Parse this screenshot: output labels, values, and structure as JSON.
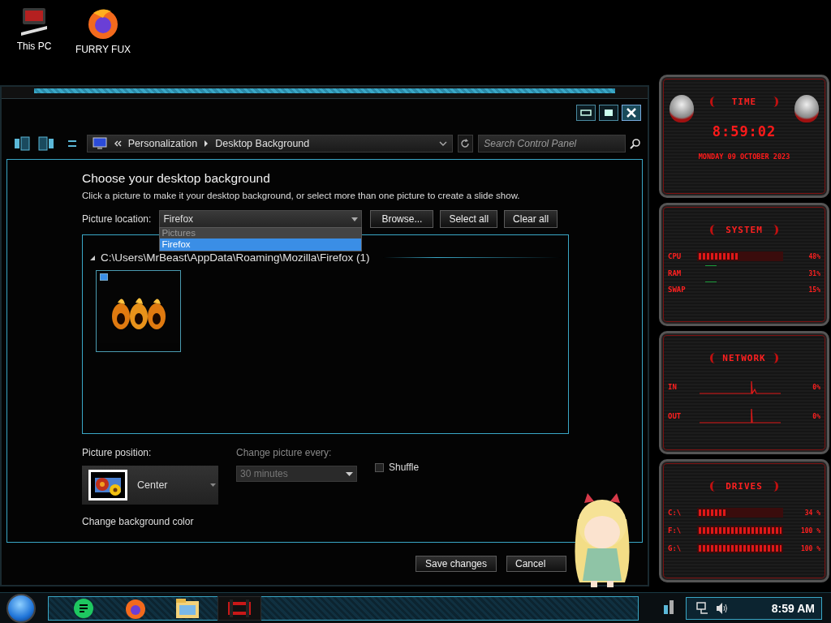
{
  "desktop_icons": [
    {
      "kind": "computer",
      "label": "This PC"
    },
    {
      "kind": "browser",
      "label": "FURRY FUX"
    }
  ],
  "window": {
    "address": {
      "crumbs": [
        "Personalization",
        "Desktop Background"
      ]
    },
    "search": {
      "placeholder": "Search Control Panel"
    },
    "heading": "Choose your desktop background",
    "description": "Click a picture to make it your desktop background, or select more than one picture to create a slide show.",
    "location": {
      "label": "Picture location:",
      "value": "Firefox",
      "options": [
        {
          "label": "Pictures",
          "selected": false
        },
        {
          "label": "Firefox",
          "selected": true
        }
      ]
    },
    "buttons": [
      "Browse...",
      "Select all",
      "Clear all"
    ],
    "group": {
      "path": "C:\\Users\\MrBeast\\AppData\\Roaming\\Mozilla\\Firefox (1)",
      "expanded": true,
      "items": [
        {
          "kind": "picture",
          "selected": true,
          "checked": true
        }
      ]
    },
    "position": {
      "label": "Picture position:",
      "value": "Center"
    },
    "interval": {
      "label": "Change picture every:",
      "value": "30 minutes",
      "disabled": true
    },
    "shuffle": {
      "label": "Shuffle",
      "checked": false
    },
    "color_link": "Change background color",
    "footer_buttons": [
      "Save changes",
      "Cancel"
    ]
  },
  "widgets": [
    {
      "kind": "clock",
      "title": "TIME",
      "time": "8:59:02",
      "date": "MONDAY 09 OCTOBER 2023"
    },
    {
      "kind": "system",
      "title": "SYSTEM",
      "rows": [
        {
          "label": "CPU",
          "level": 0.48,
          "reading": "48%"
        },
        {
          "label": "RAM",
          "reading": "31%"
        },
        {
          "label": "SWAP",
          "reading": "15%"
        }
      ]
    },
    {
      "kind": "network",
      "title": "NETWORK",
      "rows": [
        {
          "label": "IN",
          "reading": "0%"
        },
        {
          "label": "OUT",
          "reading": "0%"
        }
      ]
    },
    {
      "kind": "drives",
      "title": "DRIVES",
      "rows": [
        {
          "label": "C:\\",
          "level": 0.34,
          "reading": "34 %"
        },
        {
          "label": "F:\\",
          "level": 1,
          "reading": "100 %"
        },
        {
          "label": "G:\\",
          "level": 1,
          "reading": "100 %"
        }
      ]
    }
  ],
  "taskbar": {
    "apps": [
      {
        "kind": "chat",
        "selected": false
      },
      {
        "kind": "browser",
        "selected": false
      },
      {
        "kind": "folder",
        "selected": false
      },
      {
        "kind": "game",
        "selected": true
      }
    ],
    "clock": "8:59 AM"
  }
}
